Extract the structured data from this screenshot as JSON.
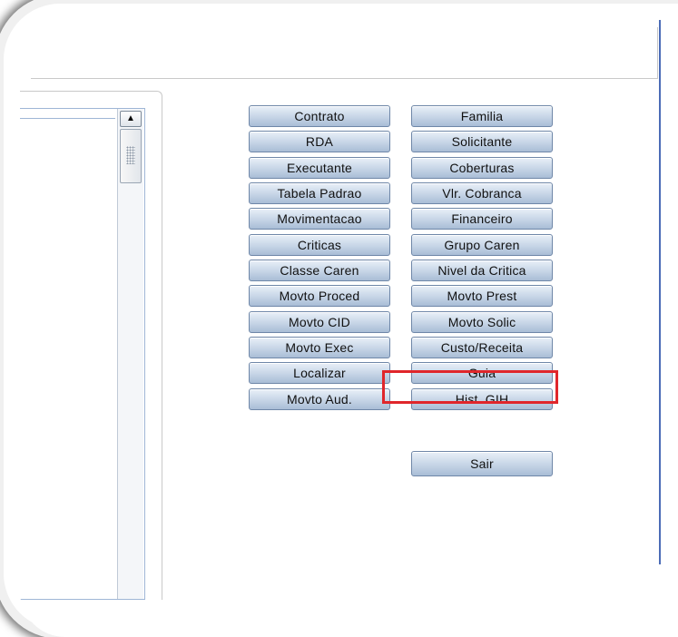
{
  "left_column_buttons": [
    "Contrato",
    "RDA",
    "Executante",
    "Tabela Padrao",
    "Movimentacao",
    "Criticas",
    "Classe Caren",
    "Movto Proced",
    "Movto CID",
    "Movto Exec",
    "Localizar",
    "Movto Aud."
  ],
  "right_column_buttons": [
    "Familia",
    "Solicitante",
    "Coberturas",
    "Vlr. Cobranca",
    "Financeiro",
    "Grupo Caren",
    "Nivel da Critica",
    "Movto Prest",
    "Movto Solic",
    "Custo/Receita",
    "Guia",
    "Hist. GIH"
  ],
  "exit_button": "Sair",
  "scroll_up_glyph": "▲",
  "colors": {
    "highlight_border": "#e0262b",
    "button_border": "#6f87a8",
    "accent_line": "#4b6cb7"
  }
}
